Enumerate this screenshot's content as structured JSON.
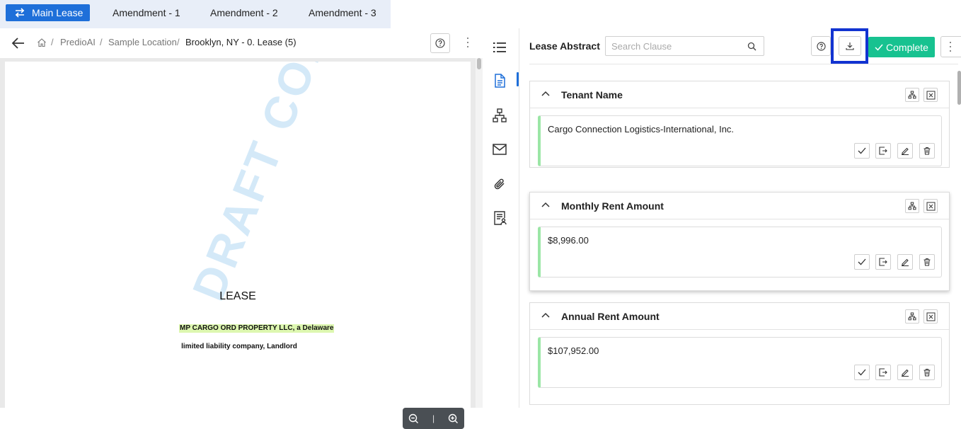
{
  "tabs": [
    {
      "label": "Main Lease",
      "active": true
    },
    {
      "label": "Amendment - 1",
      "active": false
    },
    {
      "label": "Amendment - 2",
      "active": false
    },
    {
      "label": "Amendment - 3",
      "active": false
    }
  ],
  "breadcrumb": {
    "items": [
      "PredioAI",
      "Sample Location",
      "Brooklyn, NY - 0. Lease (5)"
    ],
    "separator": "/"
  },
  "document": {
    "title": "LEASE",
    "highlighted_line": "MP CARGO ORD PROPERTY LLC, a Delaware",
    "line2": "limited liability company, Landlord",
    "watermark": "DRAFT COPY",
    "zoom_separator": "|"
  },
  "abstract": {
    "title": "Lease Abstract",
    "search_placeholder": "Search Clause",
    "complete_label": "Complete",
    "cards": [
      {
        "title": "Tenant Name",
        "value": "Cargo Connection Logistics-International, Inc."
      },
      {
        "title": "Monthly Rent Amount",
        "value": "$8,996.00"
      },
      {
        "title": "Annual Rent Amount",
        "value": "$107,952.00"
      }
    ]
  },
  "colors": {
    "accent": "#1e6fd9",
    "complete": "#17c290",
    "highlight_frame": "#1233d1",
    "value_bar": "#9be6a6"
  }
}
